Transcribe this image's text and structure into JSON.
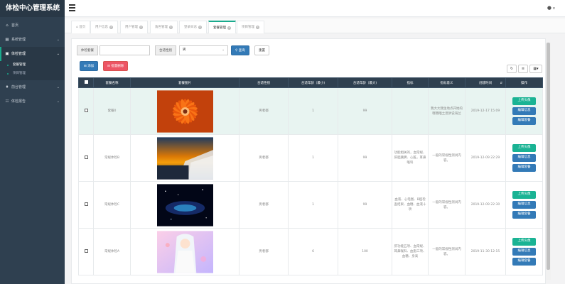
{
  "brand": "体检中心管理系统",
  "sidebar": {
    "items": [
      {
        "label": "首页",
        "icon": "home-icon"
      },
      {
        "label": "系统管理",
        "icon": "windows-icon"
      },
      {
        "label": "体检管理",
        "icon": "medkit-icon"
      },
      {
        "label": "前台管理",
        "icon": "diamond-icon"
      },
      {
        "label": "体检报告",
        "icon": "calendar-icon"
      }
    ],
    "sub_items": [
      {
        "label": "套餐管理"
      },
      {
        "label": "项目管理"
      }
    ]
  },
  "tabs": [
    {
      "label": "首页"
    },
    {
      "label": "用户信息"
    },
    {
      "label": "用户管理"
    },
    {
      "label": "角色管理"
    },
    {
      "label": "登录日志"
    },
    {
      "label": "套餐管理"
    },
    {
      "label": "项目管理"
    }
  ],
  "search": {
    "name_label": "体检套餐",
    "name_value": "",
    "gender_label": "合适性别",
    "gender_value": "男",
    "query_label": "查询",
    "reset_label": "重置"
  },
  "toolbar": {
    "add_label": "添加",
    "batch_delete_label": "批量删除"
  },
  "table": {
    "headers": [
      "套餐名称",
      "套餐图片",
      "合适性别",
      "合适年龄（最小)",
      "合适年龄（最大)",
      "指标",
      "指标意义",
      "创建时间",
      "操作"
    ],
    "actions": [
      "上传头像",
      "编辑信息",
      "编辑套餐"
    ],
    "rows": [
      {
        "name": "套餐0",
        "gender": "男者都",
        "min_age": "1",
        "max_age": "99",
        "indicator": "",
        "meaning": "我大大我生地点开始的哦哦晒土澳洪说海兰",
        "created": "2019-12-17 15:09",
        "image": "flower",
        "highlight": true
      },
      {
        "name": "常规体检B",
        "gender": "男者都",
        "min_age": "1",
        "max_age": "99",
        "indicator": "功能相关的，血常规、肝胆胰脾、心脏，耳鼻喉科",
        "meaning": "一般的常规性测试内容。",
        "created": "2019-12-09 22:29",
        "image": "sunset",
        "highlight": false
      },
      {
        "name": "常规体检C",
        "gender": "男者都",
        "min_age": "1",
        "max_age": "99",
        "indicator": "血液、心电图、B超检查结果、血糖、血液十项",
        "meaning": "一般的常规性测试内容。",
        "created": "2019-12-09 22:30",
        "image": "space",
        "highlight": false
      },
      {
        "name": "常规体检A",
        "gender": "男者都",
        "min_age": "6",
        "max_age": "100",
        "indicator": "肝功能五项、血常规、耳鼻喉科、血脂三项、血糖、身高",
        "meaning": "一般的常规性测试内容。",
        "created": "2019-11-30 12:15",
        "image": "anime",
        "highlight": false
      }
    ]
  },
  "colors": {
    "sidebar_bg": "#2f4050",
    "accent": "#1ab394",
    "primary": "#337ab7",
    "danger": "#ed5565"
  }
}
